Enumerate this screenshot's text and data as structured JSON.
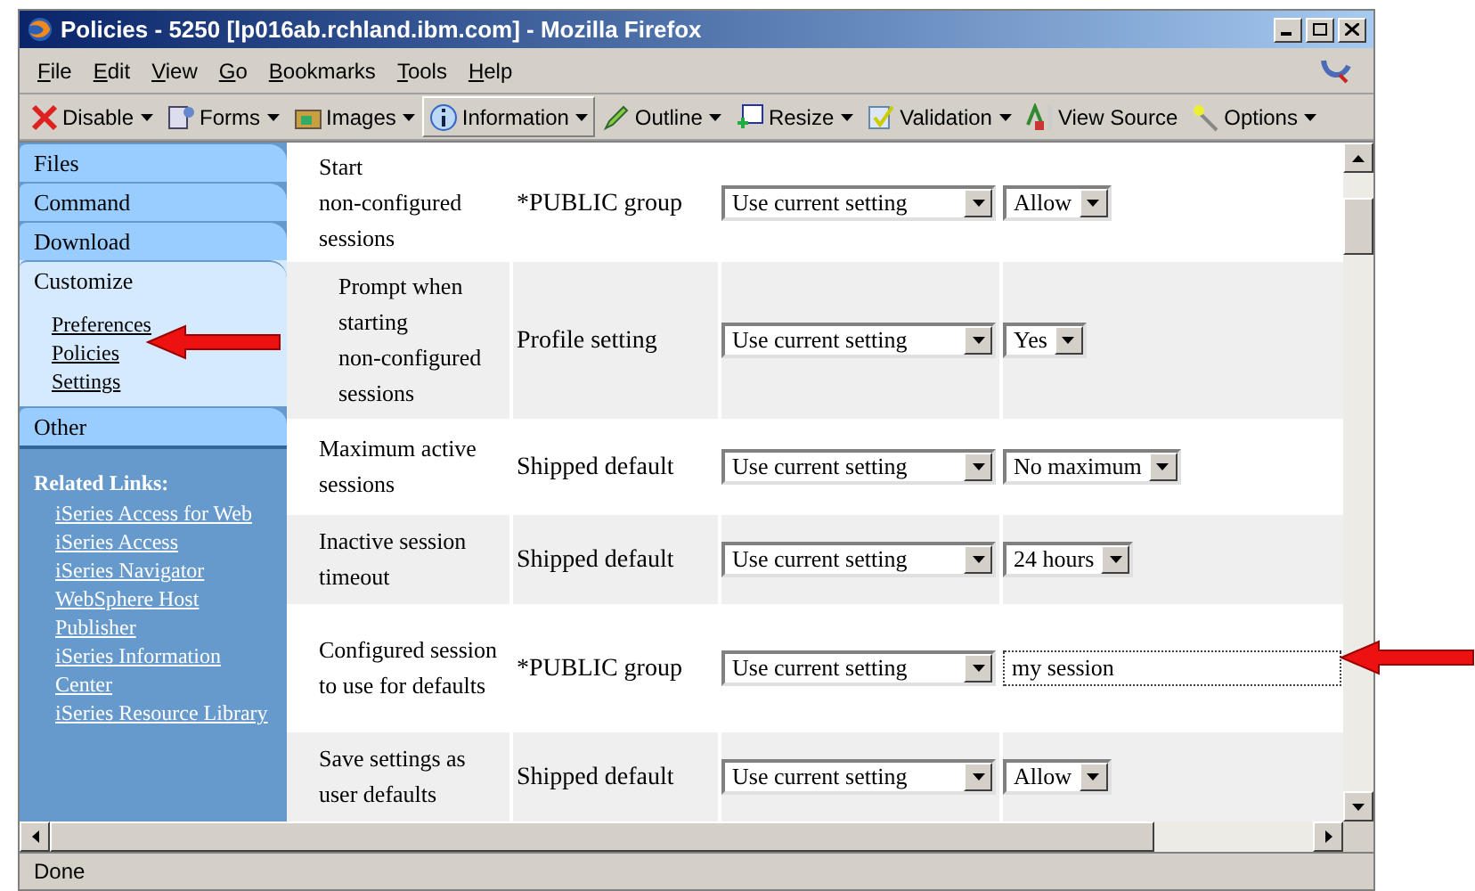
{
  "window": {
    "title": "Policies - 5250 [lp016ab.rchland.ibm.com] - Mozilla Firefox"
  },
  "menu": [
    "File",
    "Edit",
    "View",
    "Go",
    "Bookmarks",
    "Tools",
    "Help"
  ],
  "toolbar": [
    {
      "label": "Disable",
      "dropdown": true,
      "pressed": false
    },
    {
      "label": "Forms",
      "dropdown": true,
      "pressed": false
    },
    {
      "label": "Images",
      "dropdown": true,
      "pressed": false
    },
    {
      "label": "Information",
      "dropdown": true,
      "pressed": true
    },
    {
      "label": "Outline",
      "dropdown": true,
      "pressed": false
    },
    {
      "label": "Resize",
      "dropdown": true,
      "pressed": false
    },
    {
      "label": "Validation",
      "dropdown": true,
      "pressed": false
    },
    {
      "label": "View Source",
      "dropdown": false,
      "pressed": false
    },
    {
      "label": "Options",
      "dropdown": true,
      "pressed": false
    }
  ],
  "sidebar": {
    "items": [
      {
        "label": "Files",
        "selected": false
      },
      {
        "label": "Command",
        "selected": false
      },
      {
        "label": "Download",
        "selected": false
      },
      {
        "label": "Customize",
        "selected": true,
        "children": [
          {
            "label": "Preferences"
          },
          {
            "label": "Policies"
          },
          {
            "label": "Settings"
          }
        ]
      },
      {
        "label": "Other",
        "selected": false
      }
    ],
    "related_links": {
      "title": "Related Links:",
      "links": [
        "iSeries Access for Web",
        "iSeries Access",
        "iSeries Navigator",
        "WebSphere Host",
        "Publisher",
        "iSeries Information",
        "Center",
        "iSeries Resource Library"
      ]
    }
  },
  "table": {
    "rows": [
      {
        "label": "Start non-configured sessions",
        "indented": false,
        "source": "*PUBLIC group",
        "action": "Use current setting",
        "value": {
          "kind": "select",
          "text": "Allow"
        }
      },
      {
        "label": "Prompt when starting non-configured sessions",
        "indented": true,
        "source": "Profile setting",
        "action": "Use current setting",
        "value": {
          "kind": "select",
          "text": "Yes"
        }
      },
      {
        "label": "Maximum active sessions",
        "indented": false,
        "source": "Shipped default",
        "action": "Use current setting",
        "value": {
          "kind": "select",
          "text": "No maximum"
        }
      },
      {
        "label": "Inactive session timeout",
        "indented": false,
        "source": "Shipped default",
        "action": "Use current setting",
        "value": {
          "kind": "select",
          "text": "24 hours"
        }
      },
      {
        "label": "Configured session to use for defaults",
        "indented": false,
        "source": "*PUBLIC group",
        "action": "Use current setting",
        "value": {
          "kind": "field",
          "text": "my session"
        }
      },
      {
        "label": "Save settings as user defaults",
        "indented": false,
        "source": "Shipped default",
        "action": "Use current setting",
        "value": {
          "kind": "select",
          "text": "Allow"
        }
      }
    ]
  },
  "status_bar": {
    "text": "Done"
  }
}
